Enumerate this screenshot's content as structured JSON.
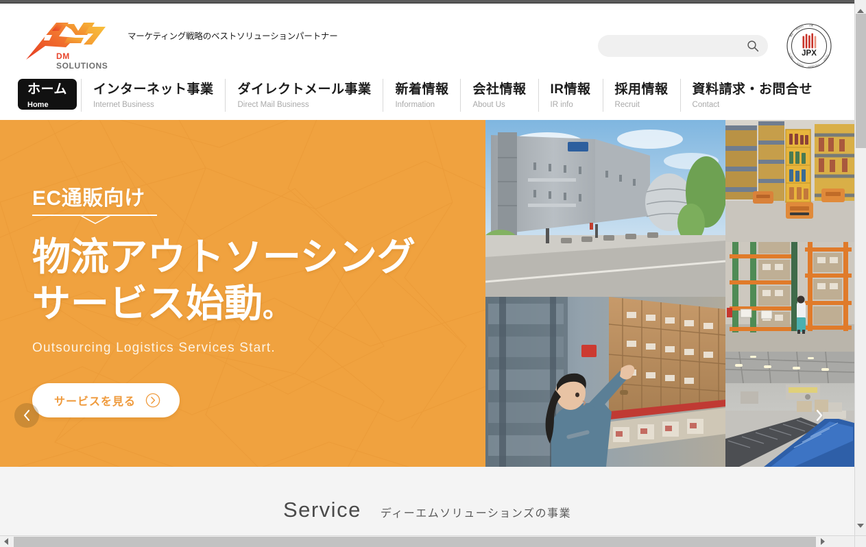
{
  "brand": {
    "logo_text_dm": "DM",
    "logo_text_solutions": "SOLUTIONS",
    "tagline": "マーケティング戦略のベストソリューションパートナー",
    "accent_orange": "#f0a23f",
    "accent_red": "#e8462d",
    "accent_yellow": "#f5a623"
  },
  "search": {
    "value": "",
    "placeholder": "",
    "icon": "search-icon"
  },
  "badge": {
    "label": "JPX",
    "ring_text_top": "東証JASDAQ上場",
    "ring_text_bottom": "TOKYO STOCK EXCHANGE LISTED"
  },
  "nav": {
    "items": [
      {
        "jp": "ホーム",
        "en": "Home",
        "active": true
      },
      {
        "jp": "インターネット事業",
        "en": "Internet Business",
        "active": false
      },
      {
        "jp": "ダイレクトメール事業",
        "en": "Direct Mail Business",
        "active": false
      },
      {
        "jp": "新着情報",
        "en": "Information",
        "active": false
      },
      {
        "jp": "会社情報",
        "en": "About Us",
        "active": false
      },
      {
        "jp": "IR情報",
        "en": "IR info",
        "active": false
      },
      {
        "jp": "採用情報",
        "en": "Recruit",
        "active": false
      },
      {
        "jp": "資料請求・お問合せ",
        "en": "Contact",
        "active": false
      }
    ]
  },
  "hero": {
    "eyebrow": "EC通販向け",
    "title_line1": "物流アウトソーシング",
    "title_line2": "サービス始動",
    "title_period": "。",
    "subtitle": "Outsourcing Logistics Services Start.",
    "cta_label": "サービスを見る",
    "prev_label": "‹",
    "next_label": "›",
    "background_color": "#f0a23f",
    "photos": [
      {
        "name": "logistics-warehouse-building"
      },
      {
        "name": "woman-picking-boxes-in-warehouse"
      },
      {
        "name": "automated-robot-shelving-units"
      },
      {
        "name": "tall-pallet-racking-with-worker"
      },
      {
        "name": "conveyor-belt-sorting-facility"
      }
    ]
  },
  "service": {
    "heading_en": "Service",
    "heading_jp": "ディーエムソリューションズの事業"
  },
  "scrollbars": {
    "vertical_up": "▲",
    "vertical_down": "▼",
    "horizontal_left": "◀",
    "horizontal_right": "▶"
  }
}
